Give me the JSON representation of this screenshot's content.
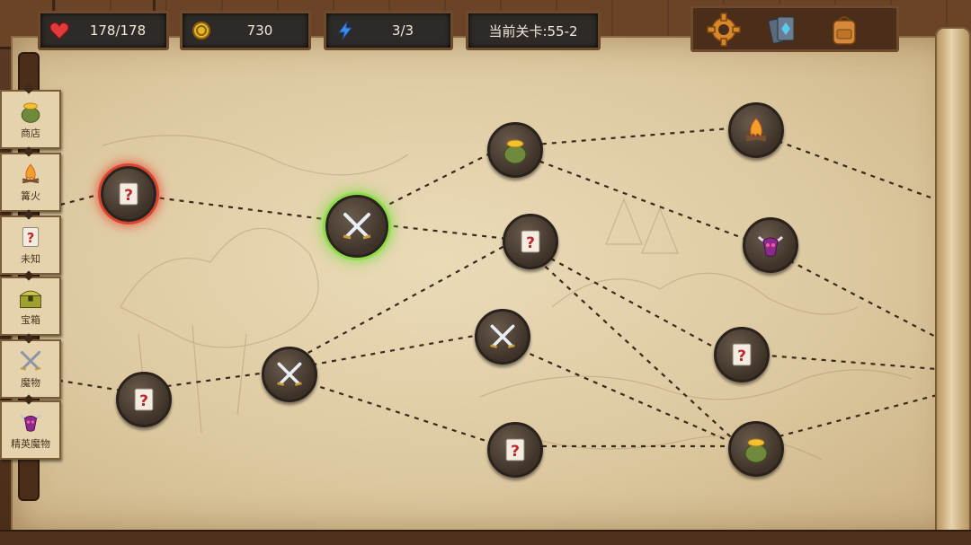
{
  "hud": {
    "health": "178/178",
    "gold": "730",
    "energy": "3/3",
    "level": "当前关卡:55-2"
  },
  "menu": [
    {
      "name": "settings",
      "icon": "gear-icon"
    },
    {
      "name": "cards",
      "icon": "card-deck-icon"
    },
    {
      "name": "backpack",
      "icon": "backpack-icon"
    }
  ],
  "legend": [
    {
      "label": "商店",
      "icon": "shop-bag-icon"
    },
    {
      "label": "篝火",
      "icon": "campfire-icon"
    },
    {
      "label": "未知",
      "icon": "unknown-card-icon"
    },
    {
      "label": "宝箱",
      "icon": "treasure-chest-icon"
    },
    {
      "label": "魔物",
      "icon": "crossed-swords-icon"
    },
    {
      "label": "精英魔物",
      "icon": "elite-demon-icon"
    }
  ],
  "nodes": [
    {
      "id": "n0",
      "type": "unknown",
      "state": "current"
    },
    {
      "id": "n1",
      "type": "monster",
      "state": "selected"
    },
    {
      "id": "n2",
      "type": "shop",
      "state": "normal"
    },
    {
      "id": "n3",
      "type": "campfire",
      "state": "normal"
    },
    {
      "id": "n4",
      "type": "unknown",
      "state": "normal"
    },
    {
      "id": "n5",
      "type": "elite",
      "state": "normal"
    },
    {
      "id": "n6",
      "type": "unknown",
      "state": "normal"
    },
    {
      "id": "n7",
      "type": "monster",
      "state": "normal"
    },
    {
      "id": "n8",
      "type": "monster",
      "state": "normal"
    },
    {
      "id": "n9",
      "type": "unknown",
      "state": "normal"
    },
    {
      "id": "n10",
      "type": "unknown",
      "state": "normal"
    },
    {
      "id": "n11",
      "type": "shop",
      "state": "normal"
    }
  ],
  "colors": {
    "current": "#d9452f",
    "selected": "#8fdc4a",
    "path": "#3a2a1c"
  }
}
